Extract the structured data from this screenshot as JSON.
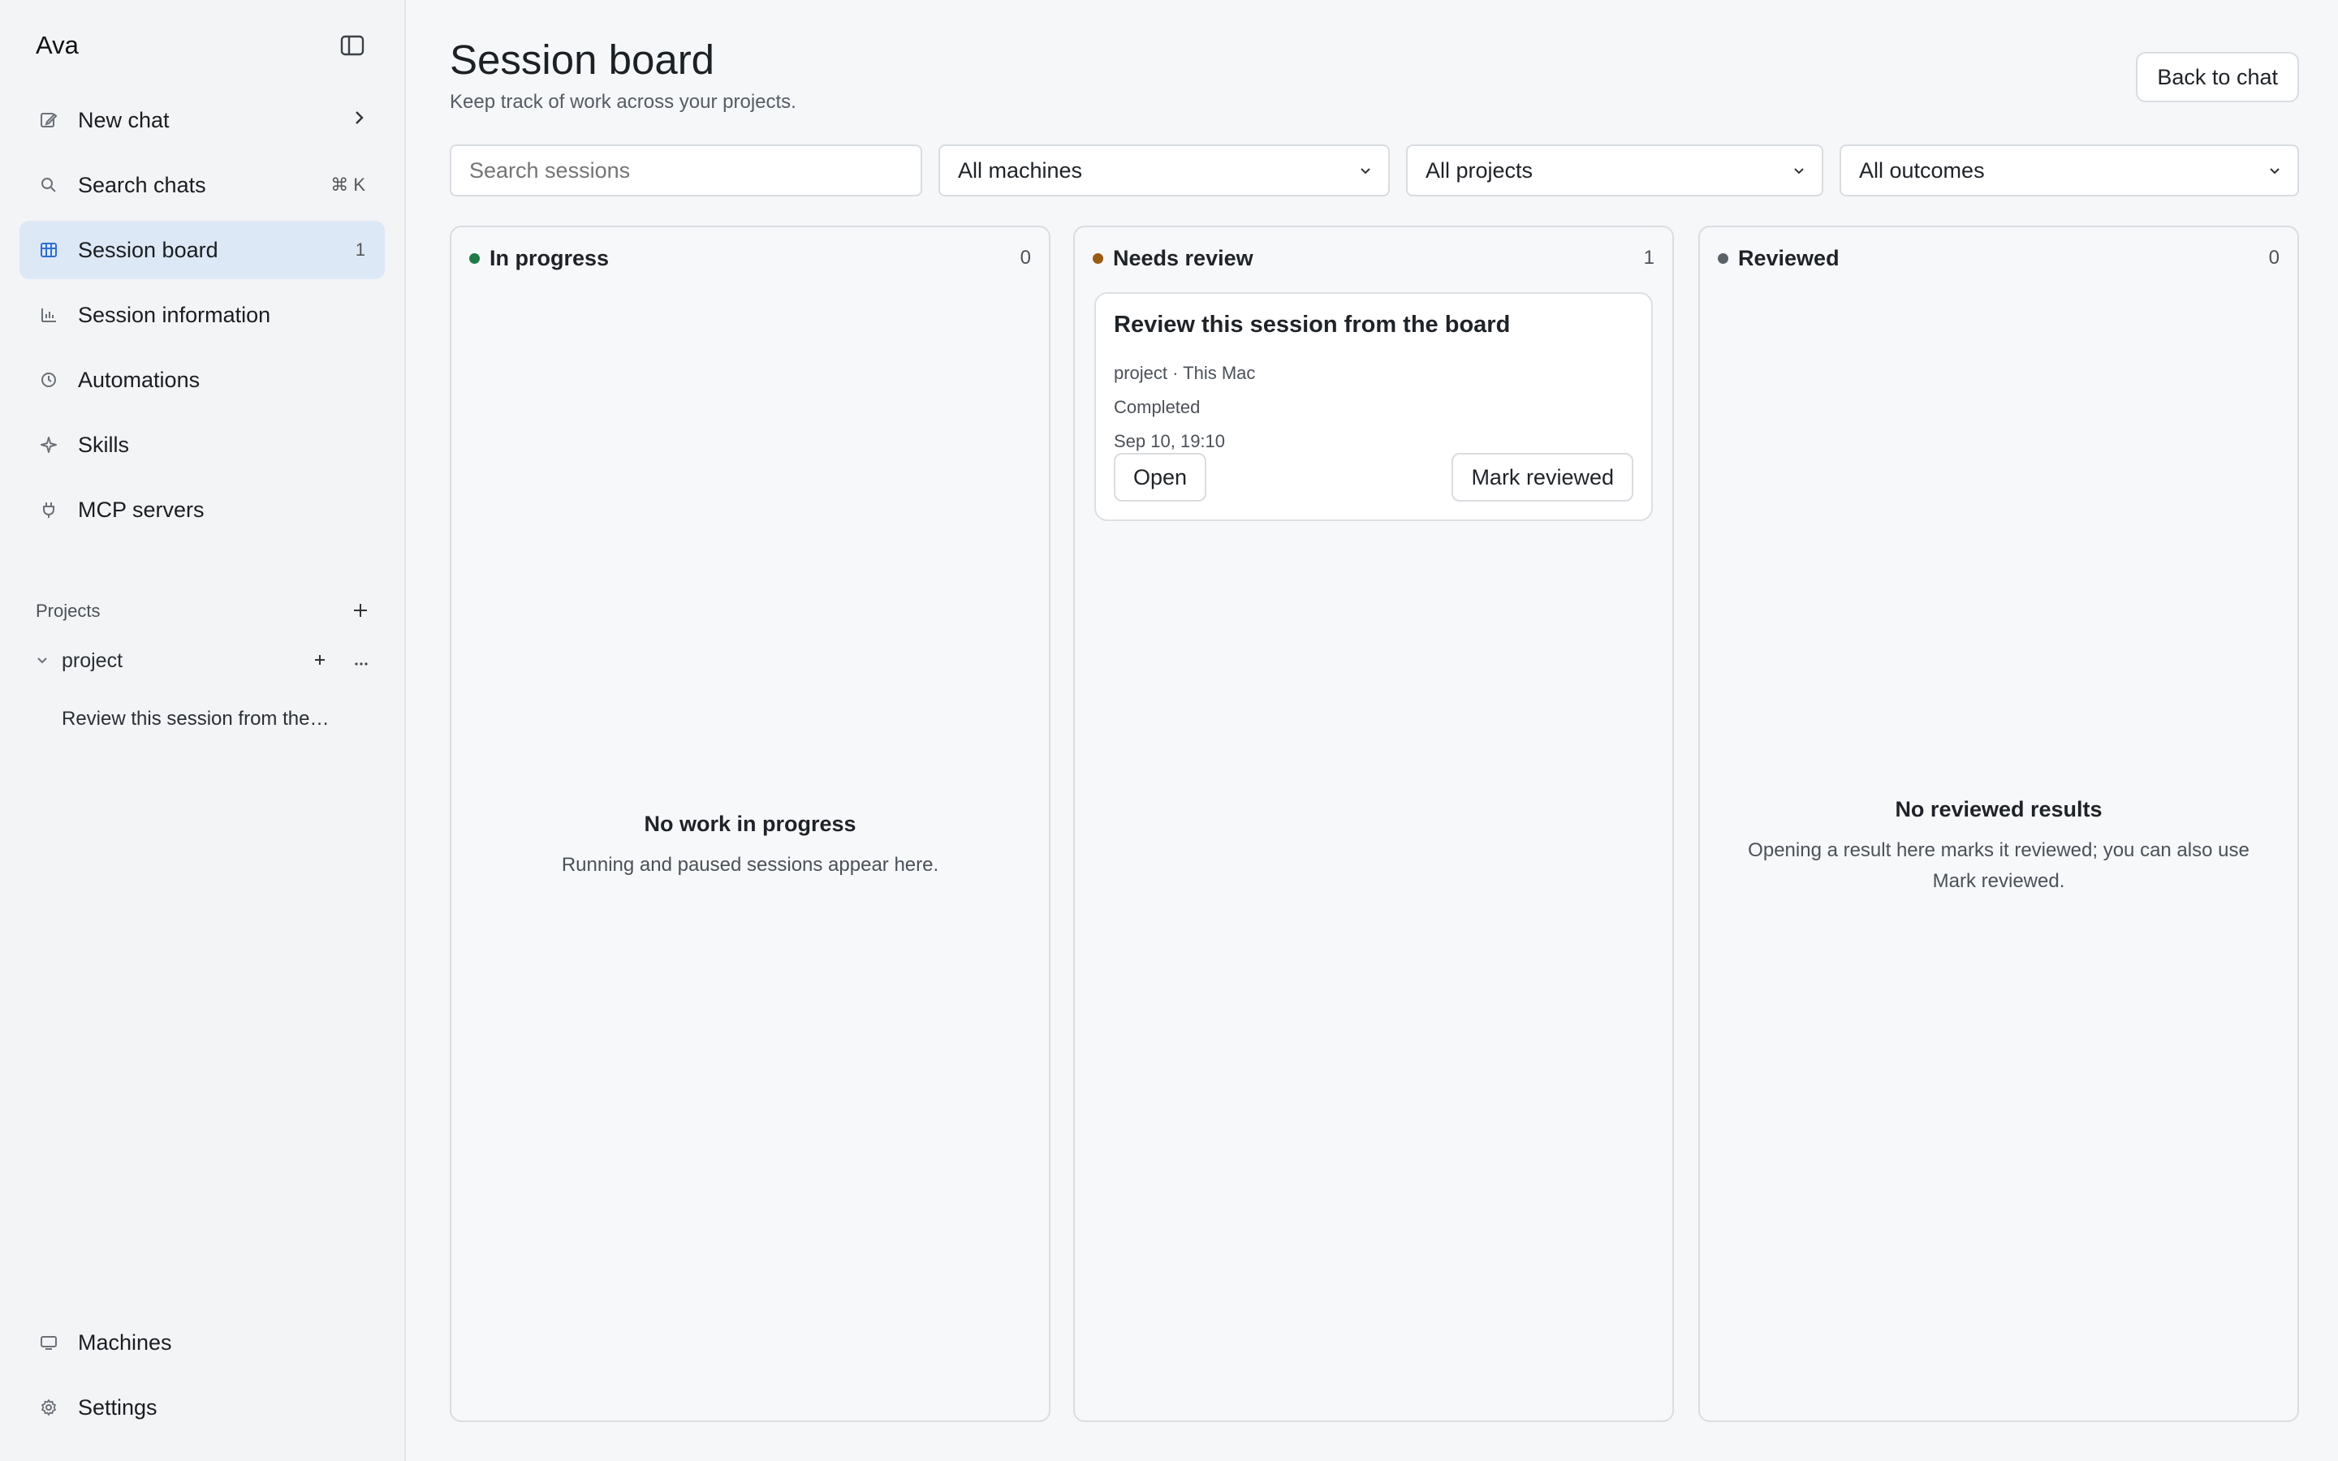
{
  "sidebar": {
    "brand": "Ava",
    "nav": [
      {
        "label": "New chat",
        "right": "›"
      },
      {
        "label": "Search chats",
        "right": "⌘ K"
      },
      {
        "label": "Session board",
        "right": "1"
      },
      {
        "label": "Session information",
        "right": ""
      },
      {
        "label": "Automations",
        "right": ""
      },
      {
        "label": "Skills",
        "right": ""
      },
      {
        "label": "MCP servers",
        "right": ""
      }
    ],
    "projects_label": "Projects",
    "project": {
      "name": "project",
      "sessions": [
        "Review this session from the…"
      ]
    },
    "bottom": [
      {
        "label": "Machines"
      },
      {
        "label": "Settings"
      }
    ]
  },
  "header": {
    "title": "Session board",
    "subtitle": "Keep track of work across your projects.",
    "back_label": "Back to chat"
  },
  "filters": {
    "search_placeholder": "Search sessions",
    "machines": "All machines",
    "projects": "All projects",
    "outcomes": "All outcomes"
  },
  "columns": [
    {
      "title": "In progress",
      "count": "0",
      "dot_color": "#1e7a46",
      "empty_title": "No work in progress",
      "empty_text": "Running and paused sessions appear here."
    },
    {
      "title": "Needs review",
      "count": "1",
      "dot_color": "#9a5a12",
      "card": {
        "title": "Review this session from the board",
        "meta": "project · This Mac",
        "status": "Completed",
        "time": "Sep 10, 19:10",
        "open_label": "Open",
        "mark_label": "Mark reviewed"
      }
    },
    {
      "title": "Reviewed",
      "count": "0",
      "dot_color": "#5b6169",
      "empty_title": "No reviewed results",
      "empty_text": "Opening a result here marks it reviewed; you can also use Mark reviewed."
    }
  ]
}
